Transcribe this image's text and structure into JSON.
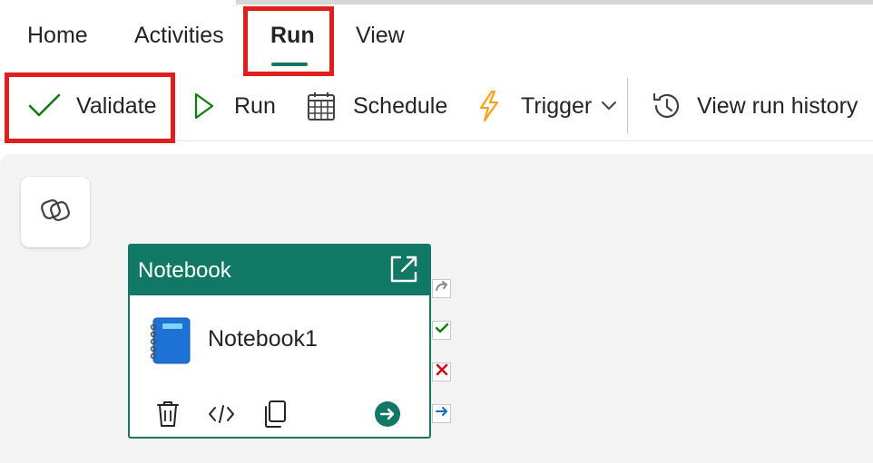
{
  "tabs": [
    {
      "label": "Home"
    },
    {
      "label": "Activities"
    },
    {
      "label": "Run"
    },
    {
      "label": "View"
    }
  ],
  "active_tab": "Run",
  "toolbar": {
    "validate_label": "Validate",
    "run_label": "Run",
    "schedule_label": "Schedule",
    "trigger_label": "Trigger",
    "view_run_history_label": "View run history"
  },
  "activity": {
    "type_label": "Notebook",
    "name": "Notebook1"
  },
  "icons": {
    "validate": "checkmark-icon",
    "run": "play-icon",
    "schedule": "calendar-icon",
    "trigger": "lightning-icon",
    "view_run_history": "history-icon",
    "copilot": "copilot-icon",
    "open": "open-external-icon",
    "notebook": "notebook-icon",
    "delete": "trash-icon",
    "code": "code-icon",
    "copy": "copy-icon",
    "next": "arrow-right-circle-icon"
  },
  "colors": {
    "accent": "#117865",
    "highlight": "#e01e1e",
    "success": "#107c10",
    "failure": "#c50f1f",
    "completion": "#0f6cbd",
    "trigger": "#f7a21b"
  }
}
